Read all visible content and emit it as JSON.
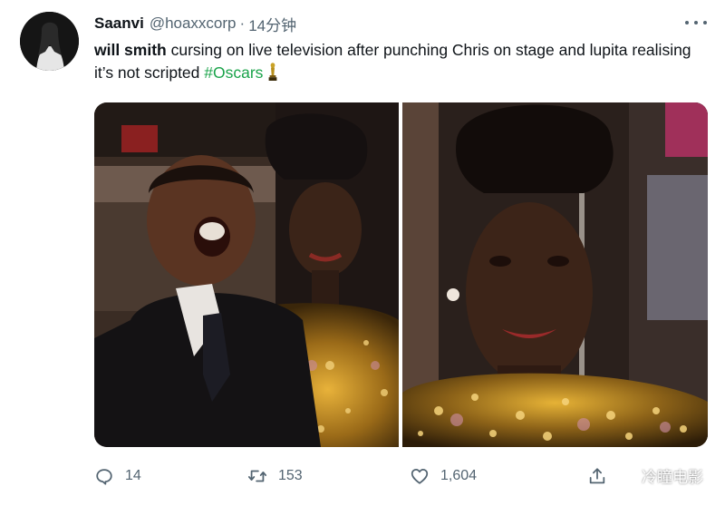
{
  "tweet": {
    "author_name": "Saanvi",
    "handle": "@hoaxxcorp",
    "separator": "·",
    "time": "14分钟",
    "text_bold": "will smith",
    "text_rest": " cursing on live television after punching Chris on stage and lupita realising it’s not scripted ",
    "hashtag": "#Oscars",
    "hashtag_color": "#1aa34a"
  },
  "actions": {
    "reply_count": "14",
    "retweet_count": "153",
    "like_count": "1,604"
  },
  "watermark": {
    "text": "冷瞳电影"
  },
  "icons": {
    "more": "more-horizontal-icon",
    "reply": "reply-icon",
    "retweet": "retweet-icon",
    "like": "heart-icon",
    "share": "share-icon",
    "trophy": "trophy-icon"
  },
  "colors": {
    "text_primary": "#0f1419",
    "text_secondary": "#536471"
  }
}
